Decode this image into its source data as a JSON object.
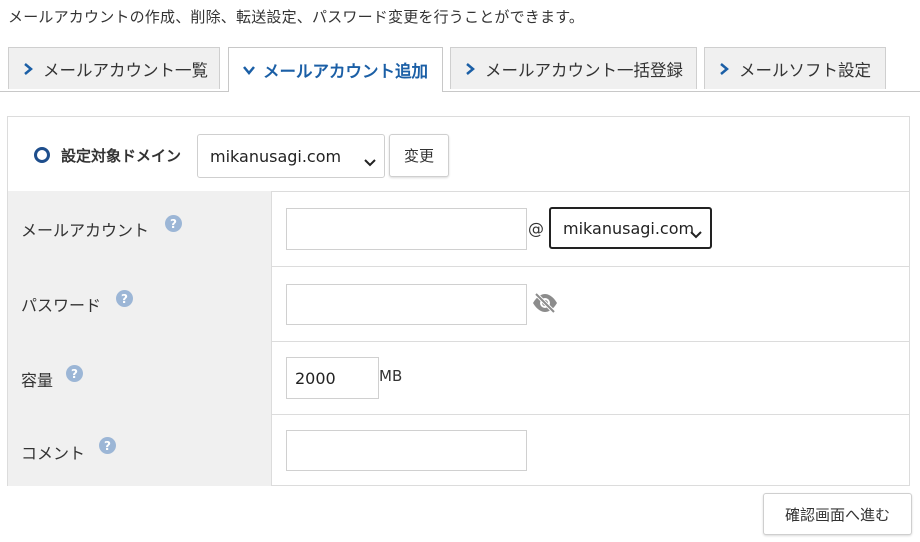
{
  "description": "メールアカウントの作成、削除、転送設定、パスワード変更を行うことができます。",
  "tabs": [
    {
      "label": "メールアカウント一覧",
      "active": false,
      "icon": "chevron-right-icon"
    },
    {
      "label": "メールアカウント追加",
      "active": true,
      "icon": "chevron-down-icon"
    },
    {
      "label": "メールアカウント一括登録",
      "active": false,
      "icon": "chevron-right-icon"
    },
    {
      "label": "メールソフト設定",
      "active": false,
      "icon": "chevron-right-icon"
    }
  ],
  "domain_target": {
    "label": "設定対象ドメイン",
    "selected": "mikanusagi.com",
    "change_button": "変更"
  },
  "form": {
    "mail_account": {
      "label": "メールアカウント",
      "value": "",
      "at": "@",
      "domain_selected": "mikanusagi.com"
    },
    "password": {
      "label": "パスワード",
      "value": ""
    },
    "capacity": {
      "label": "容量",
      "value": "2000",
      "unit": "MB"
    },
    "comment": {
      "label": "コメント",
      "value": ""
    },
    "help_glyph": "?"
  },
  "confirm_button": "確認画面へ進む",
  "colors": {
    "accent": "#1b5fa6",
    "help_badge": "#9cb6d6",
    "label_bg": "#f0f0f0"
  }
}
